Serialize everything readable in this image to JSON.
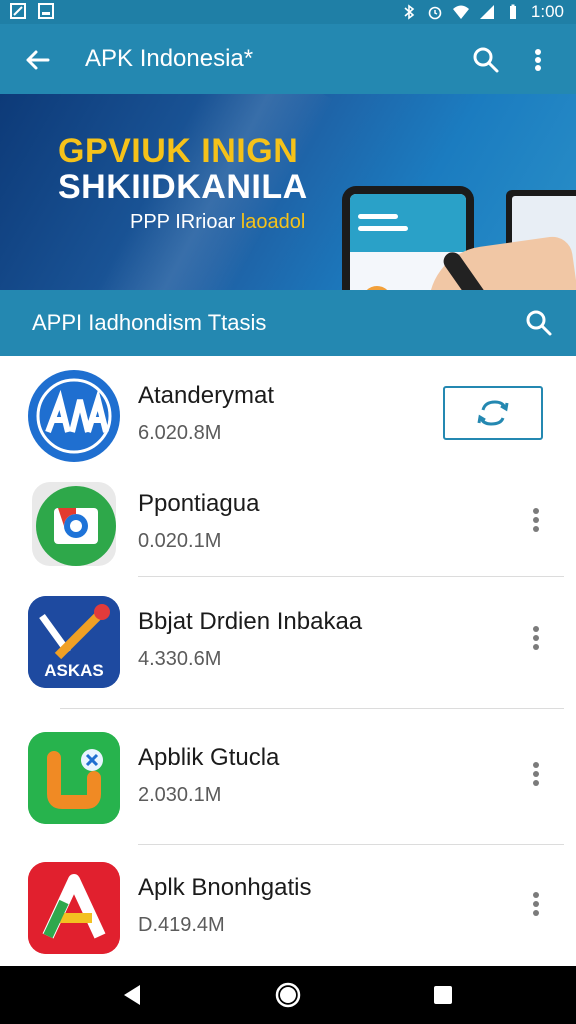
{
  "status_bar": {
    "time": "1:00",
    "icons": [
      "notification-icon",
      "photo-icon",
      "bluetooth-icon",
      "alarm-icon",
      "wifi-icon",
      "signal-icon",
      "battery-icon"
    ]
  },
  "app_bar": {
    "title": "APK Indonesia*",
    "icons": [
      "back-arrow-icon",
      "search-icon",
      "more-vert-icon"
    ]
  },
  "banner": {
    "headline_line1": "GPVIUK INIGN",
    "headline_line2": "SHKIIDKANILA",
    "subtitle_part1": "PPP IRrioar",
    "subtitle_part2": "laoadol"
  },
  "section": {
    "label": "APPI Iadhondism Ttasis"
  },
  "apps": [
    {
      "name": "Atanderymat",
      "size": "6.020.8M",
      "icon": "aia-app-icon",
      "action": "update-icon"
    },
    {
      "name": "Ppontiagua",
      "size": "0.020.1M",
      "icon": "browser-app-icon",
      "action": "more-vert-icon"
    },
    {
      "name": "Bbjat Drdien Inbakaa",
      "size": "4.330.6M",
      "icon": "askas-app-icon",
      "icon_text": "ASKAS",
      "action": "more-vert-icon"
    },
    {
      "name": "Apblik Gtucla",
      "size": "2.030.1M",
      "icon": "green-app-icon",
      "action": "more-vert-icon"
    },
    {
      "name": "Aplk Bnonhgatis",
      "size": "D.419.4M",
      "icon": "red-a-app-icon",
      "action": "more-vert-icon"
    }
  ],
  "nav_bar": {
    "icons": [
      "back-triangle-icon",
      "home-circle-icon",
      "recents-square-icon"
    ]
  },
  "colors": {
    "primary": "#2488b1",
    "status": "#1f7fa6",
    "accent_yellow": "#f5c21a"
  }
}
